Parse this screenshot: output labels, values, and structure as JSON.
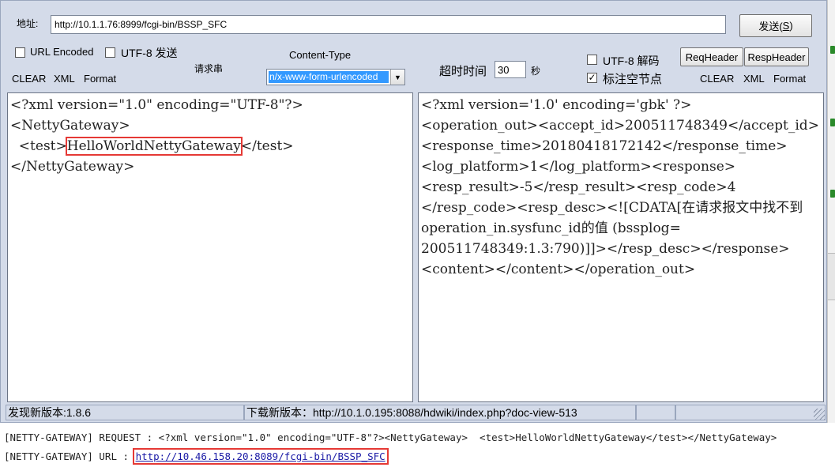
{
  "address": {
    "label": "地址:",
    "value": "http://10.1.1.76:8999/fcgi-bin/BSSP_SFC",
    "send_label": "发送(",
    "send_key": "S",
    "send_end": ")"
  },
  "left_panel": {
    "url_encoded_label": "URL Encoded",
    "utf8_send_label": "UTF-8 发送",
    "request_label": "请求串",
    "content_type_label": "Content-Type",
    "content_type_value": "n/x-www-form-urlencoded",
    "clear_label": "CLEAR",
    "xml_label": "XML",
    "format_label": "Format",
    "editor_lines": [
      "<?xml version=\"1.0\" encoding=\"UTF-8\"?>",
      "<NettyGateway>",
      "</NettyGateway>"
    ],
    "test_open": "  <test>",
    "test_value": "HelloWorldNettyGateway",
    "test_close": "</test>"
  },
  "right_panel": {
    "timeout_label": "超时时间",
    "timeout_value": "30",
    "seconds_label": "秒",
    "utf8_decode_label": "UTF-8 解码",
    "mark_empty_label": "标注空节点",
    "mark_empty_checked": "✓",
    "req_header_label": "ReqHeader",
    "resp_header_label": "RespHeader",
    "clear_label": "CLEAR",
    "xml_label": "XML",
    "format_label": "Format",
    "response_lines": [
      "<?xml version='1.0' encoding='gbk' ?>",
      "<operation_out><accept_id>200511748349</accept_id>",
      "<response_time>20180418172142</response_time>",
      "<log_platform>1</log_platform><response>",
      "<resp_result>-5</resp_result><resp_code>4",
      "</resp_code><resp_desc><![CDATA[在请求报文中找不到",
      "operation_in.sysfunc_id的值 (bssplog=",
      "200511748349:1.3:790)]]></resp_desc></response>",
      "<content></content></operation_out>"
    ]
  },
  "status_bar": {
    "new_version": "发现新版本:1.8.6",
    "download": "下载新版本：http://10.1.0.195:8088/hdwiki/index.php?doc-view-513"
  },
  "log": {
    "request_line": "[NETTY-GATEWAY] REQUEST : <?xml version=\"1.0\" encoding=\"UTF-8\"?><NettyGateway>  <test>HelloWorldNettyGateway</test></NettyGateway>",
    "url_prefix": "[NETTY-GATEWAY] URL : ",
    "url_link": "http://10.46.158.20:8089/fcgi-bin/BSSP_SFC"
  }
}
